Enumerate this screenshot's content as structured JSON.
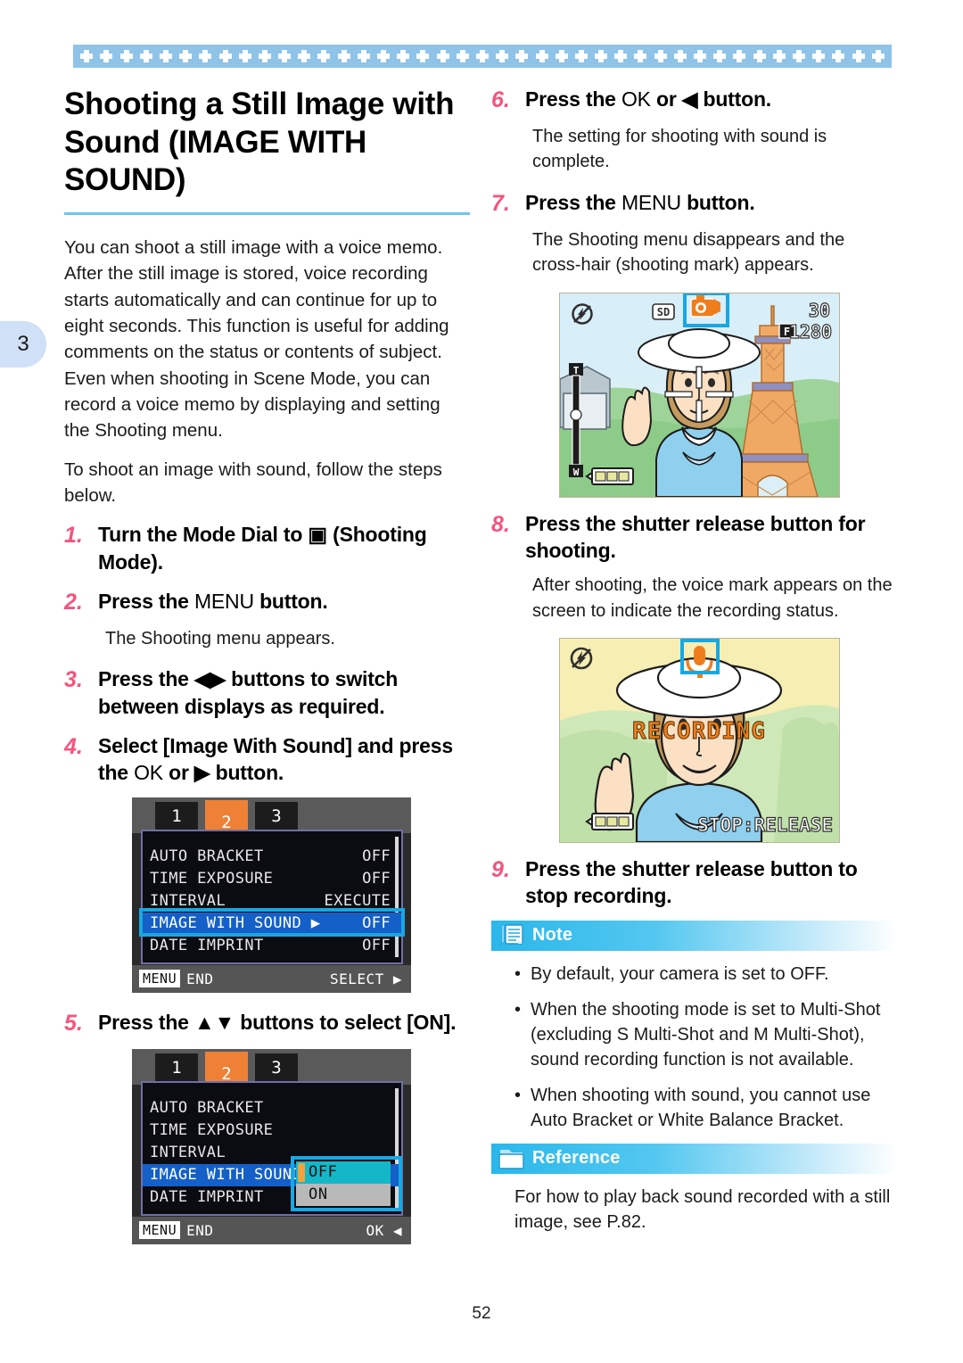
{
  "chapter_tab": "3",
  "page_number": "52",
  "title": "Shooting a Still Image with Sound (IMAGE WITH SOUND)",
  "intro": {
    "p1": "You can shoot a still image with a voice memo. After the still image is stored, voice recording starts automatically and can continue for up to eight seconds. This function is useful for adding comments on the status or contents of subject. Even when shooting in Scene Mode, you can record a voice memo by displaying and setting the Shooting menu.",
    "p2": "To shoot an image with sound, follow the steps below."
  },
  "steps": {
    "s1": {
      "num": "1.",
      "pre": "Turn the Mode Dial to ",
      "icon": "camera-icon",
      "post": " (Shooting Mode)."
    },
    "s2": {
      "num": "2.",
      "pre": "Press the ",
      "key": "MENU",
      "post": " button.",
      "desc": "The Shooting menu appears."
    },
    "s3": {
      "num": "3.",
      "pre": "Press the ",
      "icon": "◀▶",
      "post": " buttons to switch between displays as required."
    },
    "s4": {
      "num": "4.",
      "pre": "Select [Image With Sound] and press the ",
      "key": "OK",
      "mid": " or ",
      "icon": "▶",
      "post": " button."
    },
    "s5": {
      "num": "5.",
      "pre": "Press the ",
      "icon": "▲▼",
      "post": " buttons to select [ON]."
    },
    "s6": {
      "num": "6.",
      "pre": "Press the ",
      "key": "OK",
      "mid": " or ",
      "icon": "◀",
      "post": " button.",
      "desc": "The setting for shooting with sound is complete."
    },
    "s7": {
      "num": "7.",
      "pre": "Press the ",
      "key": "MENU",
      "post": " button.",
      "desc": "The Shooting menu disappears and the cross-hair (shooting mark) appears."
    },
    "s8": {
      "num": "8.",
      "text": "Press the shutter release button for shooting.",
      "desc": "After shooting, the voice mark appears on the screen to indicate the recording status."
    },
    "s9": {
      "num": "9.",
      "text": "Press the shutter release button to stop recording."
    }
  },
  "menu_screen_1": {
    "tabs": [
      "1",
      "2",
      "3"
    ],
    "active_tab": "2",
    "rows": [
      {
        "label": "AUTO BRACKET",
        "value": "OFF"
      },
      {
        "label": "TIME EXPOSURE",
        "value": "OFF"
      },
      {
        "label": "INTERVAL",
        "value": "EXECUTE"
      },
      {
        "label": "IMAGE WITH SOUND ▶",
        "value": "OFF",
        "highlighted": true
      },
      {
        "label": "DATE IMPRINT",
        "value": "OFF"
      }
    ],
    "footer_left_key": "MENU",
    "footer_left_label": "END",
    "footer_right_label": "SELECT ▶"
  },
  "menu_screen_2": {
    "tabs": [
      "1",
      "2",
      "3"
    ],
    "active_tab": "2",
    "rows": [
      {
        "label": "AUTO BRACKET",
        "value": ""
      },
      {
        "label": "TIME EXPOSURE",
        "value": ""
      },
      {
        "label": "INTERVAL",
        "value": ""
      },
      {
        "label": "IMAGE WITH SOUND ◀",
        "value": "",
        "highlighted": true
      },
      {
        "label": "DATE IMPRINT",
        "value": ""
      }
    ],
    "submenu_options": [
      "OFF",
      "ON"
    ],
    "submenu_selected": "OFF",
    "footer_left_key": "MENU",
    "footer_left_label": "END",
    "footer_right_label": "OK ◀"
  },
  "viewfinder_1": {
    "flash_icon": "flash-off-icon",
    "card_badge": "SD",
    "sound_mode_icon": "camera-with-sound-icon",
    "shots_remaining": "30",
    "quality_icon": "F",
    "image_size": "1280",
    "zoom_top_label": "T",
    "zoom_bottom_label": "W",
    "battery_icon": "battery-full-icon",
    "focus_mark": "cross-hair-mark"
  },
  "viewfinder_2": {
    "flash_icon": "flash-off-icon",
    "mic_icon": "microphone-icon",
    "status_text": "RECORDING",
    "hint_text": "STOP:RELEASE",
    "battery_icon": "battery-full-icon"
  },
  "note_box": {
    "title": "Note",
    "icon": "note-pencil-icon",
    "items": [
      "By default, your camera is set to OFF.",
      "When the shooting mode is set to Multi-Shot (excluding S Multi-Shot and M Multi-Shot), sound recording function is not available.",
      "When shooting with sound, you cannot use Auto Bracket or White Balance Bracket."
    ]
  },
  "reference_box": {
    "title": "Reference",
    "icon": "folder-icon",
    "text": "For how to play back sound recorded with a still image, see P.82."
  },
  "colors": {
    "accent_pink": "#f4547d",
    "band_blue": "#8fc3e8",
    "rule_blue": "#6ec6f0",
    "callout_cyan": "#17a8e3",
    "tab_orange": "#ef8136",
    "menu_highlight": "#1460c8"
  }
}
